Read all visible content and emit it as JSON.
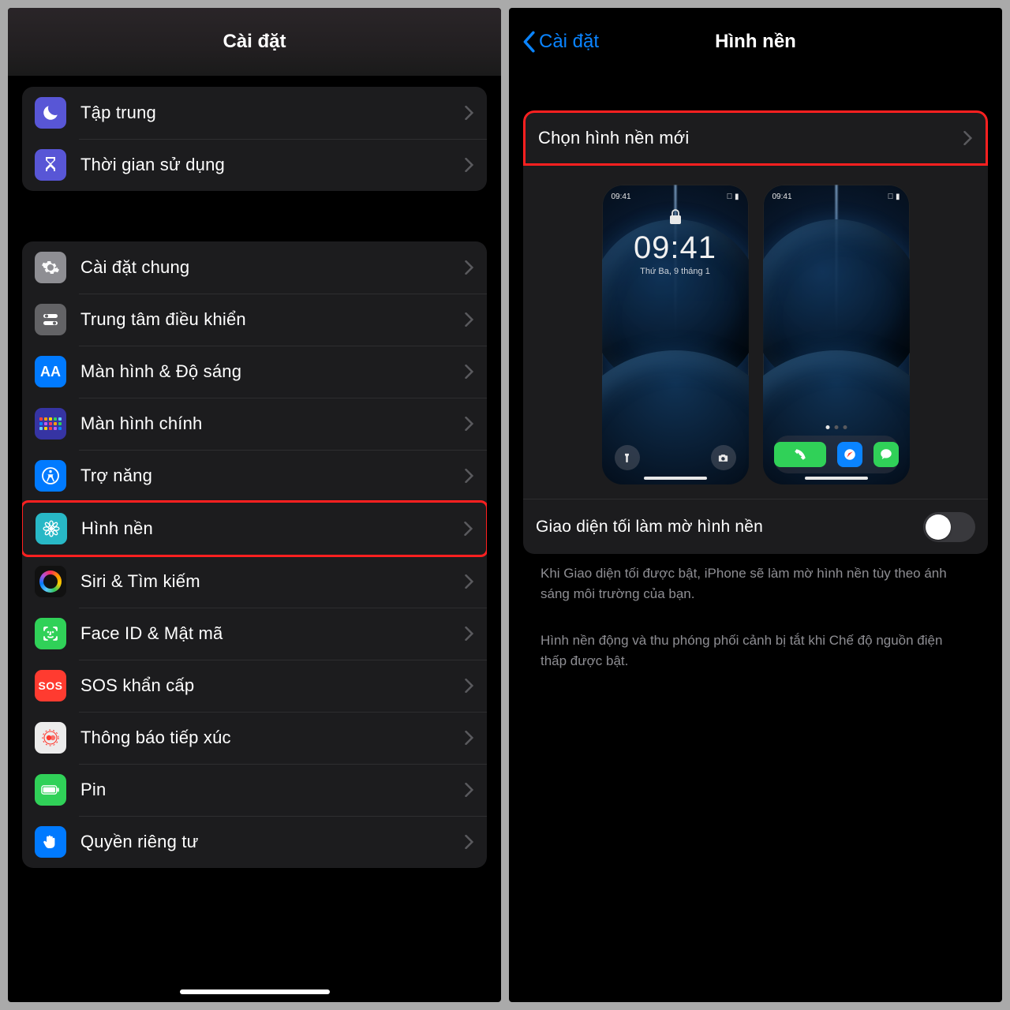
{
  "left": {
    "title": "Cài đặt",
    "group1": [
      {
        "label": "Tập trung",
        "icon": "moon"
      },
      {
        "label": "Thời gian sử dụng",
        "icon": "hourglass"
      }
    ],
    "group2": [
      {
        "label": "Cài đặt chung",
        "icon": "gear"
      },
      {
        "label": "Trung tâm điều khiển",
        "icon": "switches"
      },
      {
        "label": "Màn hình & Độ sáng",
        "icon": "aa"
      },
      {
        "label": "Màn hình chính",
        "icon": "grid"
      },
      {
        "label": "Trợ năng",
        "icon": "accessibility"
      },
      {
        "label": "Hình nền",
        "icon": "flower",
        "highlight": true
      },
      {
        "label": "Siri & Tìm kiếm",
        "icon": "siri"
      },
      {
        "label": "Face ID & Mật mã",
        "icon": "faceid"
      },
      {
        "label": "SOS khẩn cấp",
        "icon": "sos"
      },
      {
        "label": "Thông báo tiếp xúc",
        "icon": "exposure"
      },
      {
        "label": "Pin",
        "icon": "battery"
      },
      {
        "label": "Quyền riêng tư",
        "icon": "privacy"
      }
    ]
  },
  "right": {
    "back": "Cài đặt",
    "title": "Hình nền",
    "choose": "Chọn hình nền mới",
    "lock_time": "09:41",
    "lock_date": "Thứ Ba, 9 tháng 1",
    "status_time": "09:41",
    "dim_label": "Giao diện tối làm mờ hình nền",
    "note1": "Khi Giao diện tối được bật, iPhone sẽ làm mờ hình nền tùy theo ánh sáng môi trường của bạn.",
    "note2": "Hình nền động và thu phóng phối cảnh bị tắt khi Chế độ nguồn điện thấp được bật."
  }
}
